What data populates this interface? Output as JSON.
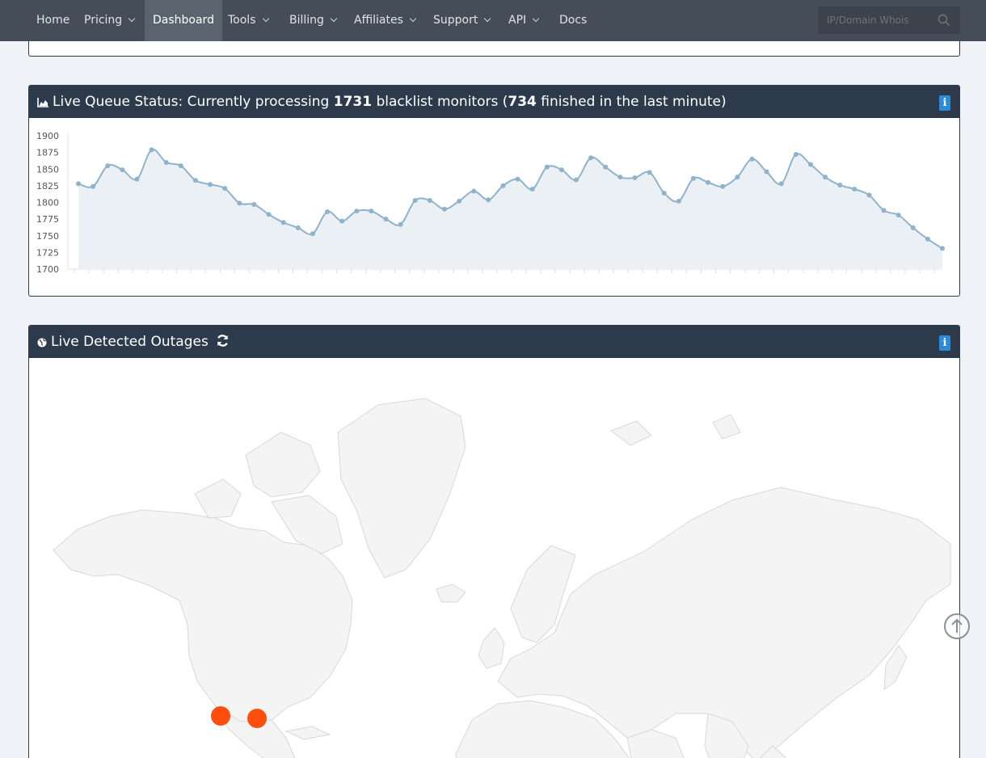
{
  "nav": {
    "items": [
      {
        "label": "Home",
        "dropdown": false,
        "active": false
      },
      {
        "label": "Pricing",
        "dropdown": true,
        "active": false
      },
      {
        "label": "Dashboard",
        "dropdown": false,
        "active": true
      },
      {
        "label": "Tools",
        "dropdown": true,
        "active": false
      },
      {
        "label": "Billing",
        "dropdown": true,
        "active": false
      },
      {
        "label": "Affiliates",
        "dropdown": true,
        "active": false
      },
      {
        "label": "Support",
        "dropdown": true,
        "active": false
      },
      {
        "label": "API",
        "dropdown": true,
        "active": false
      },
      {
        "label": "Docs",
        "dropdown": false,
        "active": false
      }
    ],
    "search_placeholder": "IP/Domain Whois"
  },
  "queue": {
    "title_prefix": "Live Queue Status: Currently processing ",
    "processing_count": "1731",
    "title_middle": " blacklist monitors (",
    "finished_count": "734",
    "title_suffix": " finished in the last minute)"
  },
  "outages": {
    "title": "Live Detected Outages"
  },
  "colors": {
    "navbar": "#454d58",
    "panel_header": "#2d3a4b",
    "info_button": "#2c8ad6",
    "line": "#8fb3cb",
    "area": "#eaf0f4",
    "outage_marker": "#ff4500"
  },
  "chart_data": {
    "type": "area",
    "title": "",
    "xlabel": "",
    "ylabel": "",
    "ylim": [
      1700,
      1900
    ],
    "yticks": [
      1900,
      1875,
      1850,
      1825,
      1800,
      1775,
      1750,
      1725,
      1700
    ],
    "series": [
      {
        "values": [
          1828,
          1824,
          1855,
          1849,
          1835,
          1879,
          1860,
          1855,
          1833,
          1827,
          1821,
          1799,
          1797,
          1782,
          1770,
          1762,
          1753,
          1786,
          1772,
          1787,
          1787,
          1775,
          1767,
          1803,
          1803,
          1790,
          1802,
          1817,
          1804,
          1825,
          1835,
          1820,
          1853,
          1849,
          1834,
          1867,
          1853,
          1838,
          1837,
          1845,
          1814,
          1802,
          1836,
          1830,
          1824,
          1838,
          1865,
          1846,
          1828,
          1872,
          1857,
          1838,
          1826,
          1820,
          1811,
          1788,
          1781,
          1762,
          1745,
          1731
        ]
      }
    ]
  }
}
